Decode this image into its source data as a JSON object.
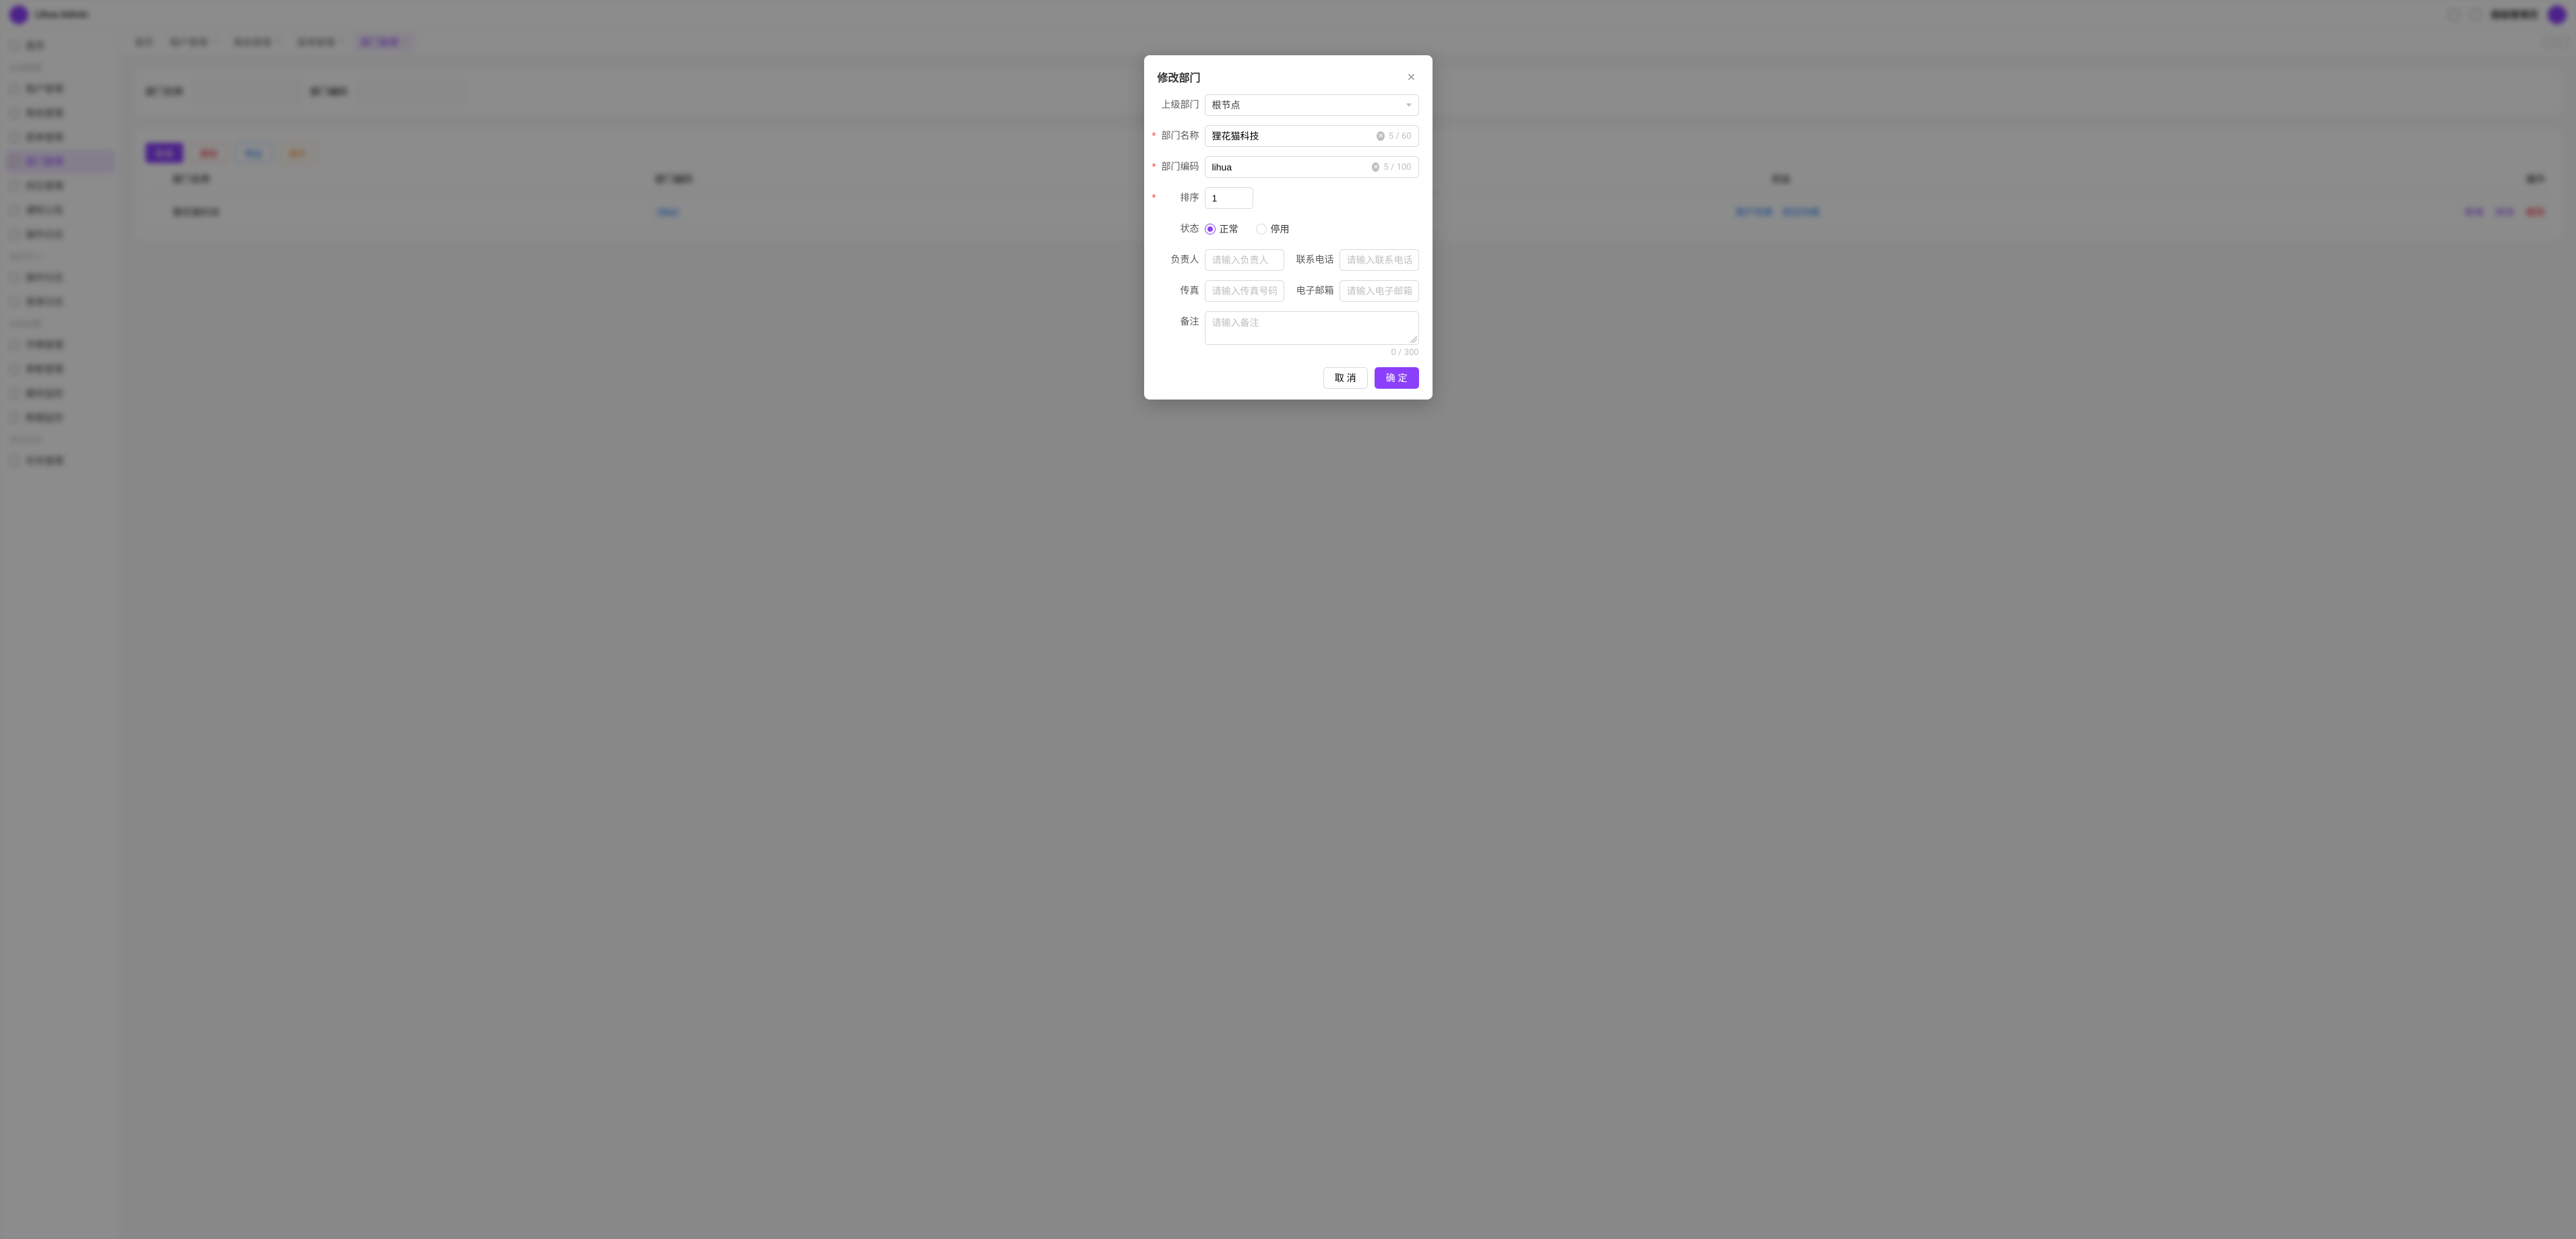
{
  "brand": "Lihua Admin",
  "topbar": {
    "adminLabel": "超级管理员"
  },
  "sidebar": {
    "top": "首页",
    "groups": [
      {
        "title": "系统管理",
        "items": [
          "租户管理",
          "角色管理",
          "菜单管理",
          "部门管理",
          "岗位管理",
          "通知公告",
          "操作日志"
        ],
        "activeIndex": 3
      },
      {
        "title": "监控中心",
        "items": [
          "操作日志",
          "登录日志"
        ]
      },
      {
        "title": "系统设置",
        "items": [
          "字典管理",
          "参数管理",
          "缓存监控",
          "数据监控"
        ]
      },
      {
        "title": "定时任务",
        "items": [
          "任务管理"
        ]
      }
    ]
  },
  "tabs": {
    "items": [
      "首页",
      "租户管理",
      "角色管理",
      "菜单管理",
      "部门管理"
    ],
    "activeIndex": 4
  },
  "filters": {
    "nameLabel": "部门名称",
    "namePlaceholder": "请输入部门名称",
    "codeLabel": "部门编码",
    "codePlaceholder": "请输入部门编码"
  },
  "toolbar": {
    "add": "新增",
    "delete": "删除",
    "export": "导出",
    "expand": "展开"
  },
  "table": {
    "headers": {
      "name": "部门名称",
      "code": "部门编码",
      "status": "状态",
      "action": "操作"
    },
    "row": {
      "name": "狸花猫科技",
      "code": "lihua",
      "statusLeft": "用户列表",
      "statusRight": "岗位列表",
      "actions": {
        "add": "新增",
        "edit": "修改",
        "del": "删除"
      }
    }
  },
  "modal": {
    "title": "修改部门",
    "labels": {
      "parent": "上级部门",
      "name": "部门名称",
      "code": "部门编码",
      "order": "排序",
      "status": "状态",
      "leader": "负责人",
      "phone": "联系电话",
      "fax": "传真",
      "email": "电子邮箱",
      "remark": "备注"
    },
    "values": {
      "parent": "根节点",
      "name": "狸花猫科技",
      "code": "lihua",
      "order": "1"
    },
    "counters": {
      "name": "5 / 60",
      "code": "5 / 100",
      "remark": "0 / 300"
    },
    "status": {
      "normal": "正常",
      "disabled": "停用",
      "checked": "normal"
    },
    "placeholders": {
      "leader": "请输入负责人",
      "phone": "请输入联系电话",
      "fax": "请输入传真号码",
      "email": "请输入电子邮箱",
      "remark": "请输入备注"
    },
    "footer": {
      "cancel": "取 消",
      "ok": "确 定"
    }
  }
}
